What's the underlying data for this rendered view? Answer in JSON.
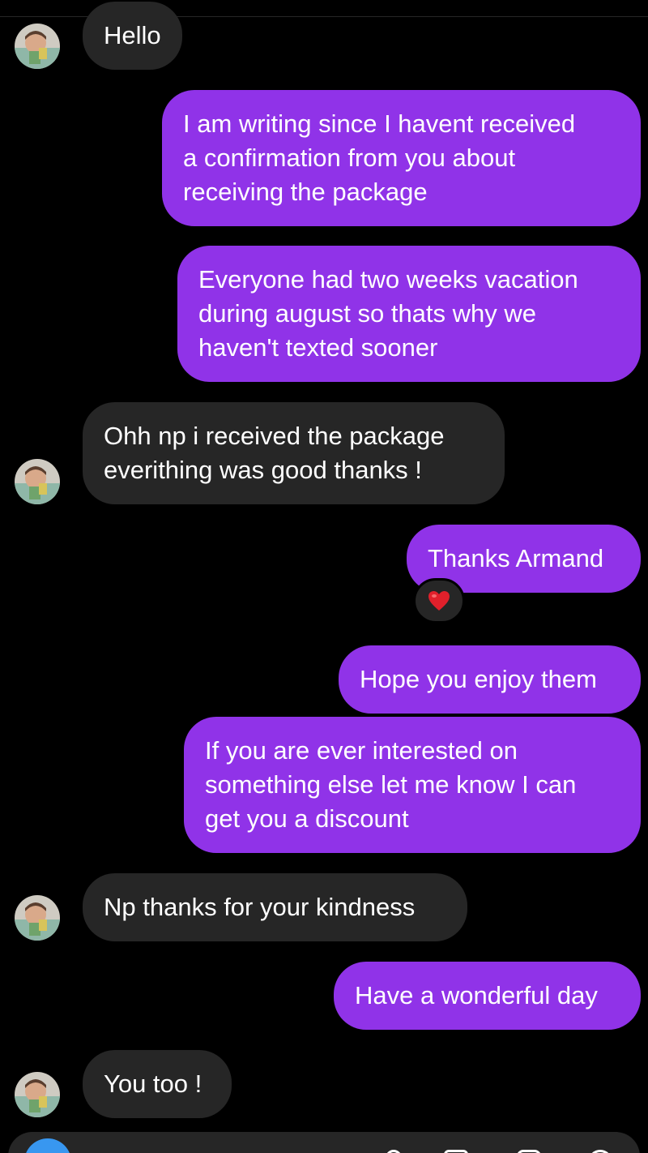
{
  "conversation": {
    "messages": [
      {
        "from": "contact",
        "text": "Hello"
      },
      {
        "from": "me",
        "text": "I am writing since I havent received\na confirmation from you about\nreceiving the package"
      },
      {
        "from": "me",
        "text": "Everyone had two weeks vacation\nduring august so thats why we\nhaven't texted sooner"
      },
      {
        "from": "contact",
        "text": "Ohh np i received the package\neverithing was good thanks !"
      },
      {
        "from": "me",
        "text": "Thanks Armand",
        "reaction": "heart-emoji"
      },
      {
        "from": "me",
        "text": "Hope you enjoy them"
      },
      {
        "from": "me",
        "text": "If you are ever interested on\nsomething else let me know I can\nget you a discount"
      },
      {
        "from": "contact",
        "text": "Np thanks for your kindness"
      },
      {
        "from": "me",
        "text": "Have a wonderful day"
      },
      {
        "from": "contact",
        "text": "You too !"
      }
    ]
  },
  "colors": {
    "background": "#000000",
    "incoming_bubble": "#262626",
    "outgoing_bubble": "#9033e8",
    "text": "#ffffff",
    "camera_button": "#3897f0"
  },
  "icons": {
    "reaction": "heart-icon",
    "composer_left": "camera-icon",
    "composer_right": [
      "microphone-icon",
      "image-icon",
      "sticker-icon",
      "emoji-icon"
    ]
  }
}
